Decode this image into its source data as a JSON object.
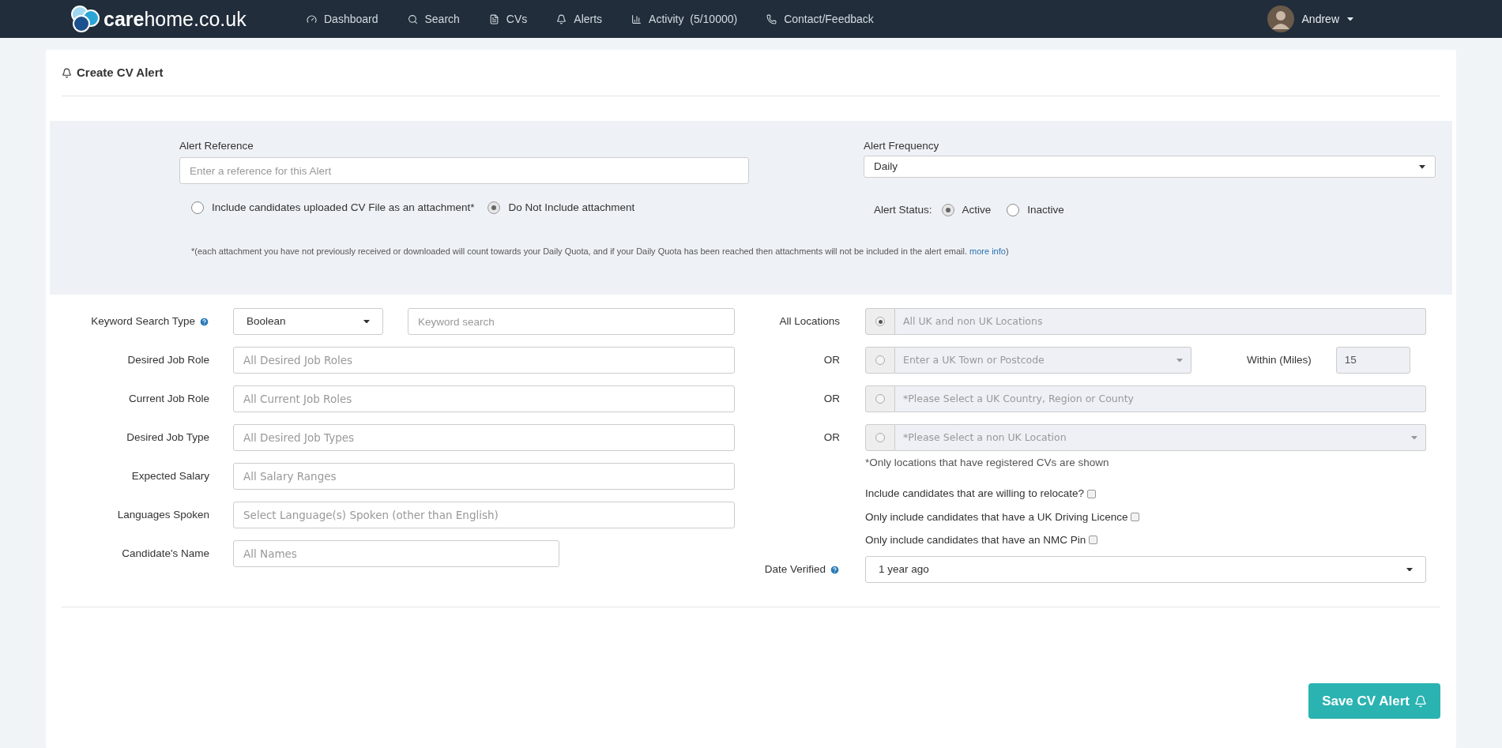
{
  "nav": {
    "logo": {
      "bold": "care",
      "rest": "home.co.uk"
    },
    "items": [
      {
        "label": "Dashboard"
      },
      {
        "label": "Search"
      },
      {
        "label": "CVs"
      },
      {
        "label": "Alerts"
      },
      {
        "label": "Activity  (5/10000)"
      },
      {
        "label": "Contact/Feedback"
      }
    ],
    "user": {
      "name": "Andrew"
    }
  },
  "page": {
    "title": "Create CV Alert"
  },
  "alert_settings": {
    "reference": {
      "label": "Alert Reference",
      "placeholder": "Enter a reference for this Alert"
    },
    "attachment_options": [
      {
        "label": "Include candidates uploaded CV File as an attachment*",
        "selected": false
      },
      {
        "label": "Do Not Include attachment",
        "selected": true
      }
    ],
    "frequency": {
      "label": "Alert Frequency",
      "value": "Daily"
    },
    "status": {
      "label": "Alert Status:",
      "options": [
        {
          "label": "Active",
          "selected": true
        },
        {
          "label": "Inactive",
          "selected": false
        }
      ]
    },
    "footnote": {
      "text": "*(each attachment you have not previously received or downloaded will count towards your Daily Quota, and if your Daily Quota has been reached then attachments will not be included in the alert email.",
      "link": "more info",
      "end": ")"
    }
  },
  "search_fields": [
    {
      "kind": "select_and_input",
      "label": "Keyword Search Type",
      "value": "Boolean",
      "placeholder": "Keyword search"
    },
    {
      "kind": "input",
      "label": "Desired Job Role",
      "placeholder": "All Desired Job Roles"
    },
    {
      "kind": "input",
      "label": "Current Job Role",
      "placeholder": "All Current Job Roles"
    },
    {
      "kind": "input",
      "label": "Desired Job Type",
      "placeholder": "All Desired Job Types"
    },
    {
      "kind": "input",
      "label": "Expected Salary",
      "placeholder": "All Salary Ranges"
    },
    {
      "kind": "input",
      "label": "Languages Spoken",
      "placeholder": "Select Language(s) Spoken (other than English)"
    },
    {
      "kind": "short_input",
      "label": "Candidate's Name",
      "placeholder": "All Names"
    }
  ],
  "locations": [
    {
      "kind": "input",
      "label": "All Locations",
      "placeholder": "All UK and non UK Locations",
      "selected": true
    },
    {
      "kind": "select_with_miles",
      "label": "OR",
      "placeholder": "Enter a UK Town or Postcode",
      "selected": false,
      "miles_label": "Within (Miles)",
      "miles_value": "15"
    },
    {
      "kind": "input",
      "label": "OR",
      "placeholder": "*Please Select a UK Country, Region or County",
      "selected": false
    },
    {
      "kind": "select",
      "label": "OR",
      "placeholder": "*Please Select a non UK Location",
      "selected": false
    }
  ],
  "locations_note": "*Only locations that have registered CVs are shown",
  "options": [
    {
      "label": "Include candidates that are willing to relocate?",
      "checked": false
    },
    {
      "label": "Only include candidates that have a UK Driving Licence",
      "checked": false
    },
    {
      "label": "Only include candidates that have an NMC Pin",
      "checked": false
    }
  ],
  "date_verified": {
    "label": "Date Verified",
    "value": "1 year ago"
  },
  "save_button": {
    "label": "Save CV Alert"
  }
}
